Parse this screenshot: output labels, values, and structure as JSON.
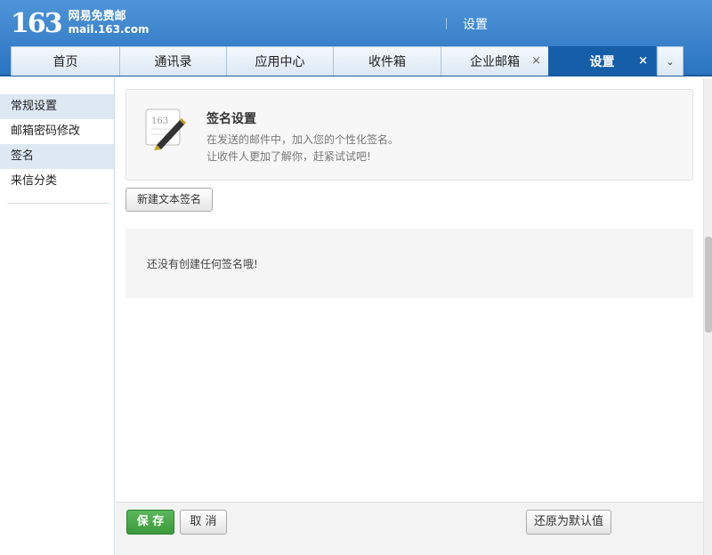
{
  "header": {
    "logo_number": "163",
    "logo_line1": "网易免费邮",
    "logo_line2": "mail.163.com",
    "title": "设置"
  },
  "tabs": [
    {
      "label": "首页"
    },
    {
      "label": "通讯录"
    },
    {
      "label": "应用中心"
    },
    {
      "label": "收件箱"
    },
    {
      "label": "企业邮箱",
      "closable": true
    },
    {
      "label": "设置",
      "closable": true,
      "active": true
    }
  ],
  "tab_close_glyph": "×",
  "tab_more_glyph": "⌄",
  "sidebar": {
    "items": [
      {
        "label": "常规设置"
      },
      {
        "label": "邮箱密码修改"
      },
      {
        "label": "签名"
      },
      {
        "label": "来信分类"
      }
    ]
  },
  "intro": {
    "icon_text": "163",
    "title": "签名设置",
    "desc_line1": "在发送的邮件中，加入您的个性化签名。",
    "desc_line2": "让收件人更加了解你，赶紧试试吧!"
  },
  "new_signature_button": "新建文本签名",
  "empty_message": "还没有创建任何签名哦!",
  "footer": {
    "save_label": "保 存",
    "cancel_label": "取 消",
    "reset_label": "还原为默认值"
  },
  "colors": {
    "header_blue": "#2a74c0",
    "active_tab": "#175ea8",
    "save_green": "#3b9a3b"
  }
}
